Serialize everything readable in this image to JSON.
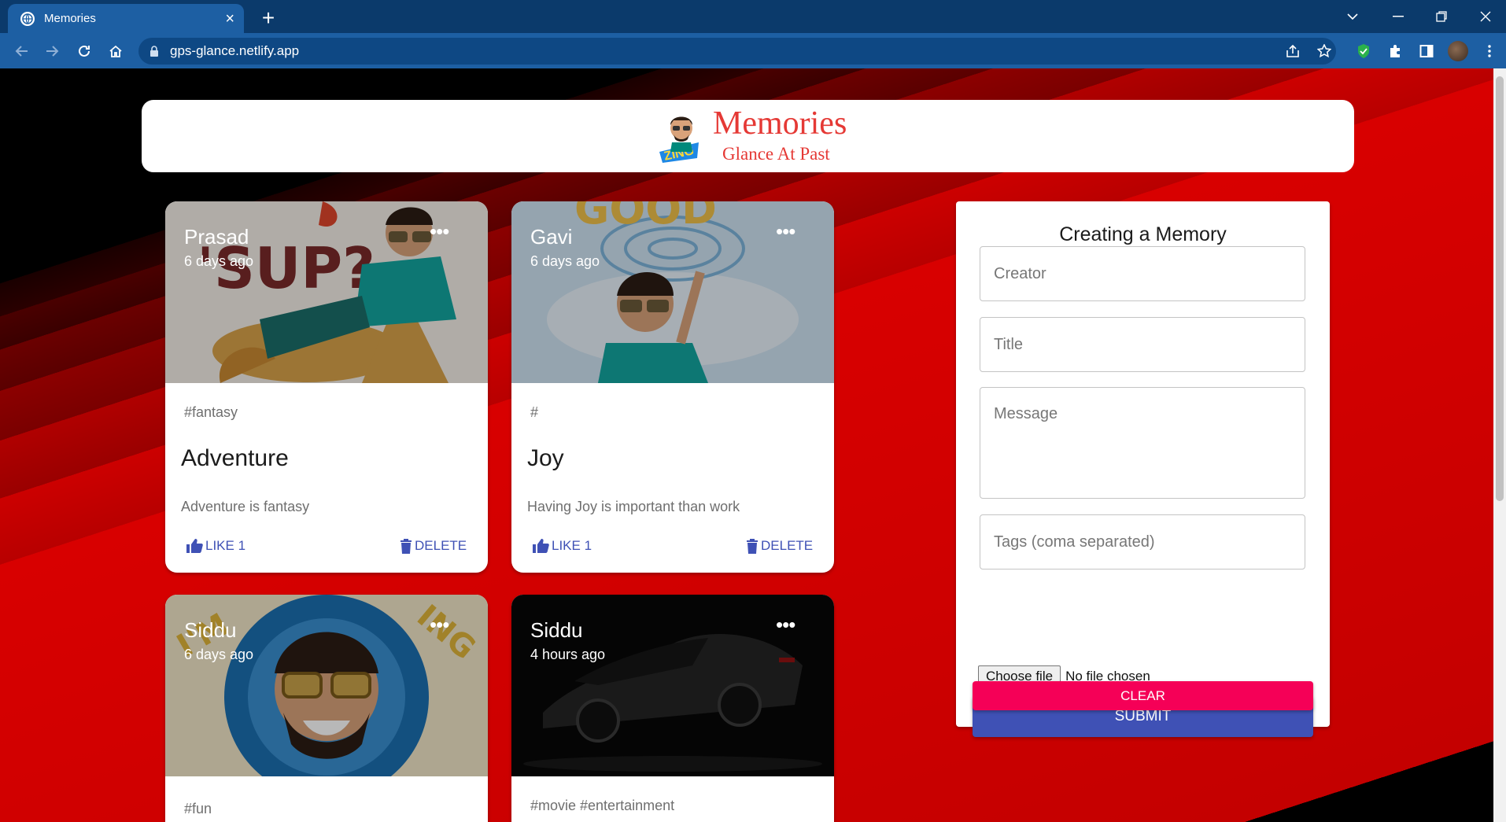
{
  "browser": {
    "tab_title": "Memories",
    "url": "gps-glance.netlify.app",
    "colors": {
      "tabbar": "#0b3a6b",
      "toolbar": "#1d5fa3"
    }
  },
  "app": {
    "title": "Memories",
    "subtitle": "Glance At Past",
    "accent": "#e53935"
  },
  "posts": [
    {
      "creator": "Prasad",
      "time": "6 days ago",
      "tags": "#fantasy",
      "title": "Adventure",
      "message": "Adventure is fantasy",
      "like_label": "LIKE 1",
      "delete_label": "DELETE"
    },
    {
      "creator": "Gavi",
      "time": "6 days ago",
      "tags": "#",
      "title": "Joy",
      "message": "Having Joy is important than work",
      "like_label": "LIKE 1",
      "delete_label": "DELETE"
    },
    {
      "creator": "Siddu",
      "time": "6 days ago",
      "tags": "#fun"
    },
    {
      "creator": "Siddu",
      "time": "4 hours ago",
      "tags": "#movie #entertainment"
    }
  ],
  "form": {
    "heading": "Creating a Memory",
    "creator_placeholder": "Creator",
    "title_placeholder": "Title",
    "message_placeholder": "Message",
    "tags_placeholder": "Tags (coma separated)",
    "file_button": "Choose file",
    "file_status": "No file chosen",
    "submit_label": "SUBMIT",
    "clear_label": "CLEAR",
    "colors": {
      "primary": "#3f51b5",
      "secondary": "#f50057"
    }
  }
}
